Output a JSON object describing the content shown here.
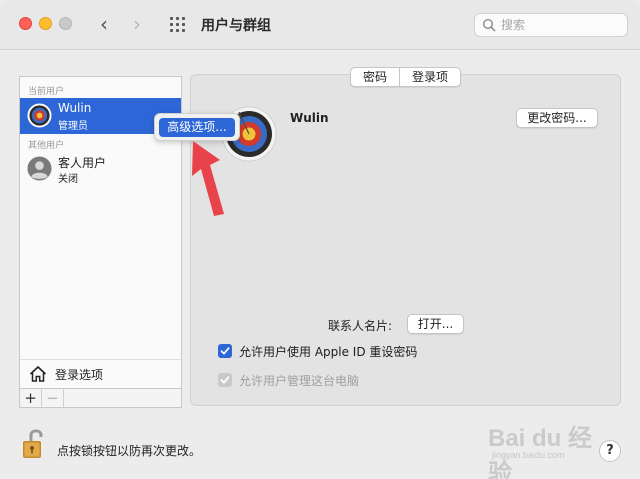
{
  "window": {
    "title": "用户与群组",
    "search_placeholder": "搜索"
  },
  "sidebar": {
    "current_users_header": "当前用户",
    "other_users_header": "其他用户",
    "users": [
      {
        "name": "Wulin",
        "role": "管理员",
        "selected": true
      },
      {
        "name": "客人用户",
        "role": "关闭",
        "selected": false
      }
    ],
    "login_options_label": "登录选项",
    "add_label": "+",
    "remove_label": "−"
  },
  "context_menu": {
    "advanced_options_label": "高级选项..."
  },
  "tabs": [
    {
      "label": "密码",
      "selected": true
    },
    {
      "label": "登录项",
      "selected": false
    }
  ],
  "main": {
    "username": "Wulin",
    "change_password_label": "更改密码...",
    "contact_card_label": "联系人名片:",
    "open_label": "打开...",
    "checkbox_apple_id": {
      "label": "允许用户使用 Apple ID 重设密码",
      "checked": true,
      "enabled": true
    },
    "checkbox_admin": {
      "label": "允许用户管理这台电脑",
      "checked": true,
      "enabled": false
    }
  },
  "footer": {
    "lock_text": "点按锁按钮以防再次更改。",
    "help_label": "?"
  },
  "watermark": {
    "brand": "Bai du 经验",
    "url": "jingyan.baidu.com"
  },
  "colors": {
    "accent": "#2d66d7",
    "annotation_arrow": "#e8424a"
  }
}
